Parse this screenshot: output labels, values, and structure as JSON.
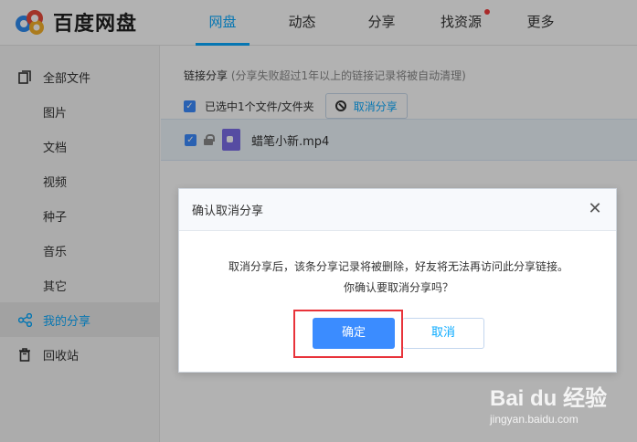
{
  "app": {
    "brand": "百度网盘",
    "nav": [
      {
        "label": "网盘"
      },
      {
        "label": "动态"
      },
      {
        "label": "分享"
      },
      {
        "label": "找资源"
      },
      {
        "label": "更多"
      }
    ]
  },
  "sidebar": {
    "items": [
      {
        "label": "全部文件",
        "icon": "files-icon"
      },
      {
        "label": "图片"
      },
      {
        "label": "文档"
      },
      {
        "label": "视频"
      },
      {
        "label": "种子"
      },
      {
        "label": "音乐"
      },
      {
        "label": "其它"
      },
      {
        "label": "我的分享",
        "icon": "share-icon"
      },
      {
        "label": "回收站",
        "icon": "trash-icon"
      }
    ]
  },
  "main": {
    "share_title": "链接分享",
    "share_note": "(分享失败超过1年以上的链接记录将被自动清理)",
    "selected_label": "已选中1个文件/文件夹",
    "cancel_share_label": "取消分享",
    "file_name": "蜡笔小新.mp4"
  },
  "dialog": {
    "title": "确认取消分享",
    "close_glyph": "✕",
    "message1": "取消分享后，该条分享记录将被删除，好友将无法再访问此分享链接。",
    "message2": "你确认要取消分享吗？",
    "confirm_label": "确定",
    "cancel_label": "取消"
  },
  "watermark": {
    "main": "Bai du 经验",
    "url": "jingyan.baidu.com"
  },
  "colors": {
    "accent": "#09aaff",
    "button_blue": "#3b8cff",
    "highlight_red": "#e8333a",
    "notify_red": "#f33b3b"
  }
}
